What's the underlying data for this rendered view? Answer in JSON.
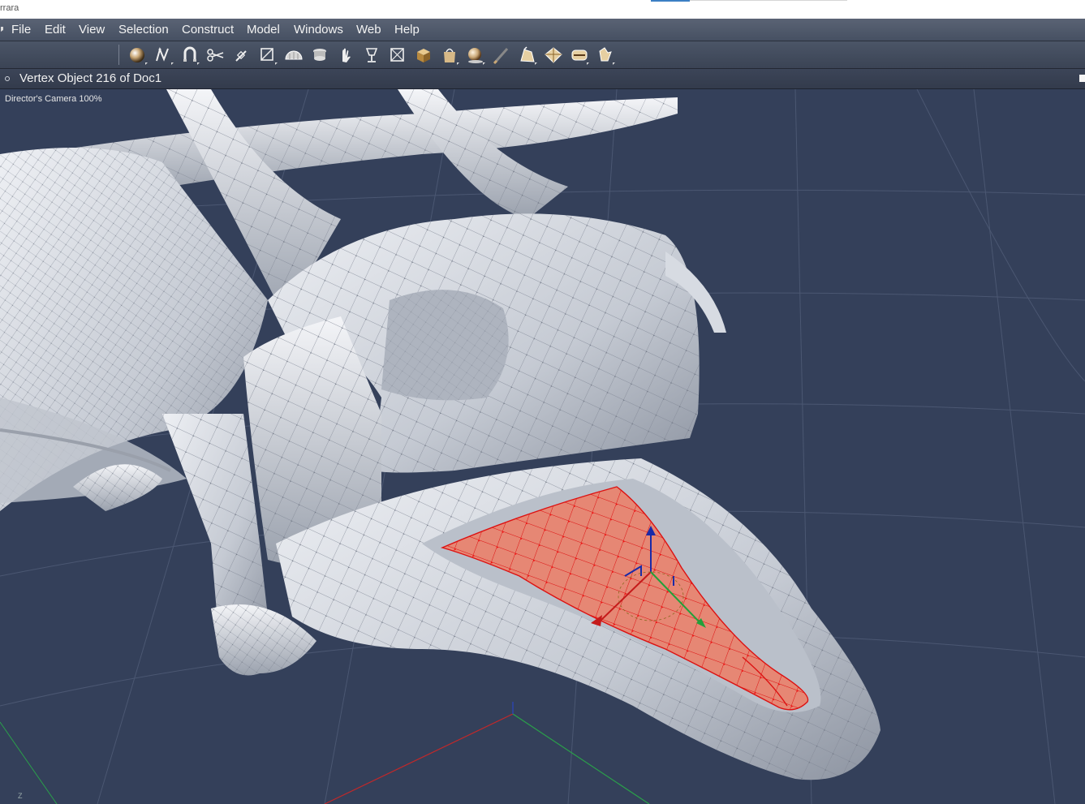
{
  "window": {
    "app_title": "rrara"
  },
  "menu": {
    "items": [
      "File",
      "Edit",
      "View",
      "Selection",
      "Construct",
      "Model",
      "Windows",
      "Web",
      "Help"
    ]
  },
  "toolbar": {
    "tools": [
      "sphere-tool-icon",
      "bezier-pen-tool-icon",
      "magnet-tool-icon",
      "scissors-tool-icon",
      "knife-tool-icon",
      "bounding-box-tool-icon",
      "half-sphere-tool-icon",
      "lathe-tool-icon",
      "hand-tool-icon",
      "goblet-tool-icon",
      "box-wireframe-tool-icon",
      "cube-tool-icon",
      "bag-tool-icon",
      "paint-ball-tool-icon",
      "brush-tool-icon",
      "rotate-tool-icon",
      "move-tool-icon",
      "scale-tool-icon",
      "grab-tool-icon"
    ]
  },
  "document": {
    "title": "Vertex Object 216 of Doc1"
  },
  "viewport": {
    "camera_label": "Director's Camera 100%",
    "axis_label": "Z"
  },
  "colors": {
    "viewport_bg": "#34405a",
    "selection": "#e9826c",
    "selection_wire": "#e02020",
    "mesh": "#d9dde4"
  }
}
